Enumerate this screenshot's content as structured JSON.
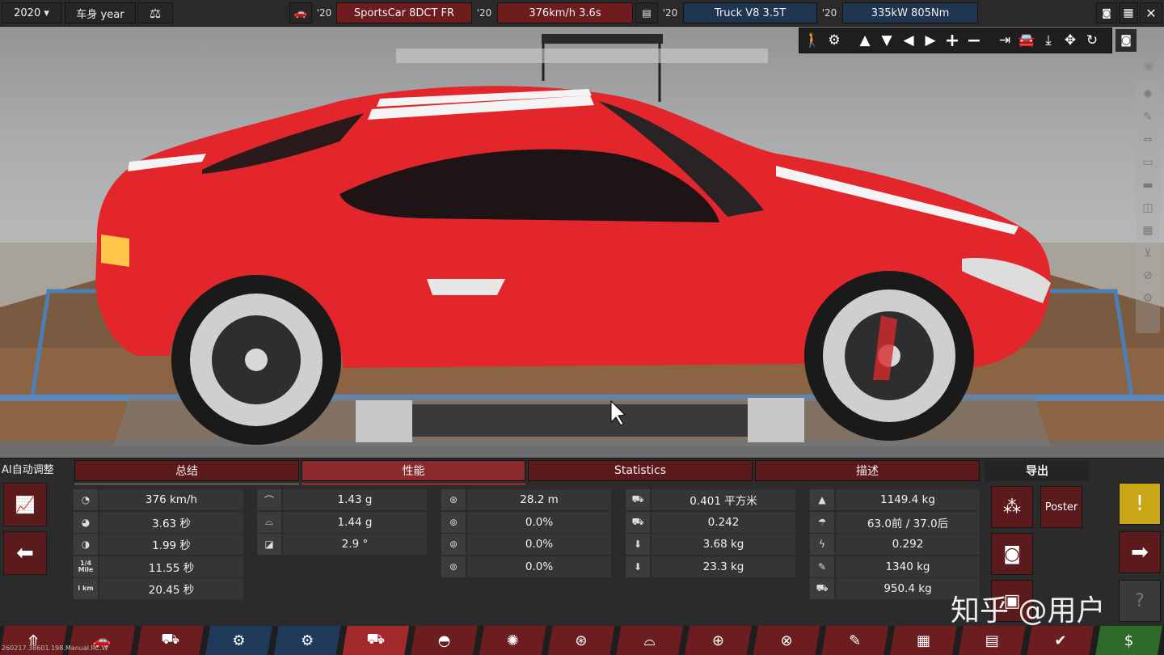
{
  "topbar": {
    "year_select": "2020 ▾",
    "body_year_label": "车身 year",
    "balance_icon": "balance-scale-icon",
    "car_icon": "car-icon",
    "yr1": "'20",
    "gearbox": "SportsCar 8DCT FR",
    "yr2": "'20",
    "perf": "376km/h 3.6s",
    "engine_icon": "engine-icon",
    "yr3": "'20",
    "engine": "Truck V8 3.5T",
    "yr4": "'20",
    "power": "335kW 805Nm",
    "screenshot_icon": "camera-icon",
    "calc_icon": "calculator-icon",
    "close_label": "✕"
  },
  "toolstrip": {
    "icons": [
      "walker-icon",
      "gear-icon",
      "arrow-up-icon",
      "arrow-down-icon",
      "arrow-left-icon",
      "arrow-right-icon",
      "plus-icon",
      "minus-icon",
      "align-right-icon",
      "car-icon",
      "anchor-down-icon",
      "move-icon",
      "rotate-icon"
    ]
  },
  "panel": {
    "ai_label": "AI自动调整",
    "tabs": [
      {
        "label": "总结",
        "active": false
      },
      {
        "label": "性能",
        "active": true
      },
      {
        "label": "Statistics",
        "active": false
      },
      {
        "label": "描述",
        "active": false
      }
    ],
    "col1": [
      {
        "icon": "speedometer-icon",
        "value": "376 km/h"
      },
      {
        "icon": "accel-gauge-icon",
        "value": "3.63 秒"
      },
      {
        "icon": "accel-gauge-2-icon",
        "value": "1.99 秒"
      },
      {
        "icon_text": "1/4 Mile",
        "value": "11.55 秒"
      },
      {
        "icon_text": "I km",
        "value": "20.45 秒"
      }
    ],
    "col2": [
      {
        "icon": "corner-grip-icon",
        "value": "1.43 g"
      },
      {
        "icon": "corner-grip-2-icon",
        "value": "1.44 g"
      },
      {
        "icon": "body-roll-icon",
        "value": "2.9 °"
      }
    ],
    "col3": [
      {
        "icon": "brake-disc-icon",
        "value": "28.2 m"
      },
      {
        "icon": "brake-fade-icon",
        "value": "0.0%"
      },
      {
        "icon": "brake-fade-2-icon",
        "value": "0.0%"
      },
      {
        "icon": "brake-fade-3-icon",
        "value": "0.0%"
      }
    ],
    "col4": [
      {
        "icon": "frontal-area-icon",
        "value": "0.401 平方米"
      },
      {
        "icon": "drag-icon",
        "value": "0.242"
      },
      {
        "icon": "downforce-front-icon",
        "value": "3.68 kg"
      },
      {
        "icon": "downforce-rear-icon",
        "value": "23.3 kg"
      }
    ],
    "col5": [
      {
        "icon": "weight-icon",
        "value": "1149.4 kg"
      },
      {
        "icon": "distribution-icon",
        "value": "63.0前 / 37.0后"
      },
      {
        "icon": "lightning-icon",
        "value": "0.292"
      },
      {
        "icon": "wrench-icon",
        "value": "1340 kg"
      },
      {
        "icon": "tow-truck-icon",
        "value": "950.4 kg"
      }
    ],
    "export_title": "导出",
    "poster_label": "Poster"
  },
  "bottomnav": {
    "items": [
      {
        "icon": "split-arrow-icon",
        "style": "red"
      },
      {
        "icon": "car-body-icon",
        "style": "red"
      },
      {
        "icon": "car-chassis-icon",
        "style": "red"
      },
      {
        "icon": "engine-block-icon",
        "style": "blue"
      },
      {
        "icon": "engine-parts-icon",
        "style": "blue"
      },
      {
        "icon": "car-spec-icon",
        "style": "active"
      },
      {
        "icon": "sun-icon",
        "style": "red"
      },
      {
        "icon": "wheel-icon",
        "style": "red"
      },
      {
        "icon": "brake-icon",
        "style": "red"
      },
      {
        "icon": "aero-icon",
        "style": "red"
      },
      {
        "icon": "seat-steer-icon",
        "style": "red"
      },
      {
        "icon": "steering-icon",
        "style": "red"
      },
      {
        "icon": "pen-icon",
        "style": "red"
      },
      {
        "icon": "checkered-flag-icon",
        "style": "red"
      },
      {
        "icon": "report-icon",
        "style": "red"
      },
      {
        "icon": "checkmark-icon",
        "style": "red"
      },
      {
        "icon": "factory-money-icon",
        "style": "green"
      }
    ]
  },
  "version": "260217.38601.198.Manual.RC.W",
  "watermark": "知乎 @用户"
}
